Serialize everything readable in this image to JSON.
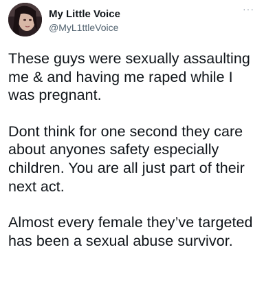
{
  "tweet": {
    "author": {
      "display_name": "My Little Voice",
      "handle": "@MyL1ttleVoice"
    },
    "more_label": "···",
    "paragraphs": [
      "These guys were sexually assaulting me & and having me raped while I was pregnant.",
      "Dont think for one second they care about anyones safety especially children. You are all just part of their next act.",
      "Almost every female they’ve targeted has been a sexual abuse survivor."
    ]
  },
  "colors": {
    "text": "#0f1419",
    "secondary": "#536471",
    "background": "#ffffff"
  },
  "icons": {
    "more": "more-horizontal-icon",
    "avatar": "profile-avatar"
  }
}
